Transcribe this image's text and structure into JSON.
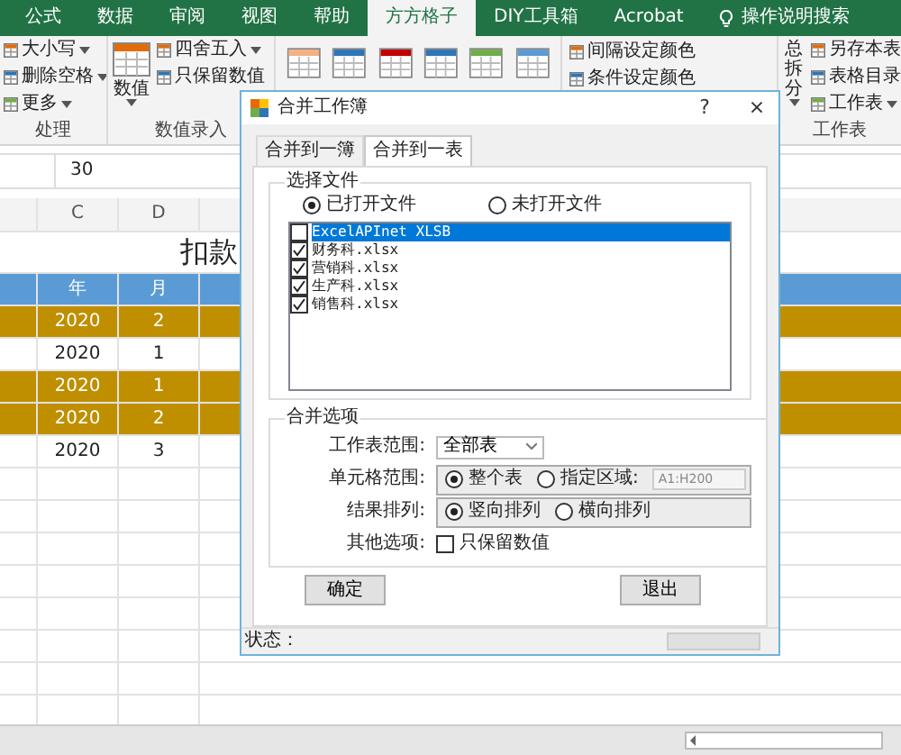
{
  "ribbon_tabs": [
    {
      "label": "公式",
      "selected": false
    },
    {
      "label": "数据",
      "selected": false
    },
    {
      "label": "审阅",
      "selected": false
    },
    {
      "label": "视图",
      "selected": false
    },
    {
      "label": "帮助",
      "selected": false
    },
    {
      "label": "方方格子",
      "selected": true
    },
    {
      "label": "DIY工具箱",
      "selected": false
    },
    {
      "label": "Acrobat",
      "selected": false
    }
  ],
  "search_hint": "操作说明搜索",
  "ribbon_left": {
    "items": [
      {
        "label": "大小写",
        "caret": true
      },
      {
        "label": "删除空格",
        "caret": true
      },
      {
        "label": "更多",
        "caret": true
      }
    ],
    "group_label": "处理"
  },
  "ribbon_values": {
    "large": {
      "label": "数值",
      "caret": true
    },
    "items": [
      {
        "label": "四舍五入",
        "caret": true
      },
      {
        "label": "只保留数值",
        "caret": false
      }
    ],
    "group_label": "数值录入"
  },
  "ribbon_colors": {
    "items": [
      {
        "label": "间隔设定颜色"
      },
      {
        "label": "条件设定颜色"
      }
    ]
  },
  "ribbon_sheet": {
    "large": {
      "label": "总拆分",
      "caret": true
    },
    "items": [
      {
        "label": "另存本表",
        "caret": false
      },
      {
        "label": "表格目录",
        "caret": false
      },
      {
        "label": "工作表",
        "caret": true
      }
    ],
    "group_label": "工作表"
  },
  "formula": "30",
  "sheet": {
    "columns": [
      "C",
      "D"
    ],
    "title": "扣款",
    "header": [
      "年",
      "月"
    ],
    "rows": [
      {
        "cells": [
          "2020",
          "2"
        ],
        "highlighted": true
      },
      {
        "cells": [
          "2020",
          "1"
        ],
        "highlighted": false
      },
      {
        "cells": [
          "2020",
          "1"
        ],
        "highlighted": true
      },
      {
        "cells": [
          "2020",
          "2"
        ],
        "highlighted": true
      },
      {
        "cells": [
          "2020",
          "3"
        ],
        "highlighted": false
      }
    ]
  },
  "dialog": {
    "title": "合并工作簿",
    "help": "?",
    "close": "×",
    "tabs": [
      {
        "label": "合并到一簿",
        "selected": false
      },
      {
        "label": "合并到一表",
        "selected": true
      }
    ],
    "file_group": {
      "legend": "选择文件",
      "sources": [
        {
          "label": "已打开文件",
          "selected": true
        },
        {
          "label": "未打开文件",
          "selected": false
        }
      ],
      "files": [
        {
          "name": "ExcelAPInet XLSB",
          "checked": false,
          "selected": true
        },
        {
          "name": "财务科.xlsx",
          "checked": true,
          "selected": false
        },
        {
          "name": "营销科.xlsx",
          "checked": true,
          "selected": false
        },
        {
          "name": "生产科.xlsx",
          "checked": true,
          "selected": false
        },
        {
          "name": "销售科.xlsx",
          "checked": true,
          "selected": false
        }
      ]
    },
    "options": {
      "legend": "合并选项",
      "sheet_range": {
        "label": "工作表范围:",
        "value": "全部表"
      },
      "cell_range": {
        "label": "单元格范围:",
        "choices": [
          {
            "label": "整个表",
            "selected": true
          },
          {
            "label": "指定区域:",
            "selected": false
          }
        ],
        "range": {
          "value": "A1:H200",
          "disabled": true
        }
      },
      "arrange": {
        "label": "结果排列:",
        "choices": [
          {
            "label": "竖向排列",
            "selected": true
          },
          {
            "label": "横向排列",
            "selected": false
          }
        ]
      },
      "other": {
        "label": "其他选项:",
        "checkbox": {
          "label": "只保留数值",
          "checked": false
        }
      }
    },
    "buttons": [
      "确定",
      "退出"
    ],
    "status": {
      "label": "状态：",
      "progress": {
        "level": 0
      }
    }
  }
}
